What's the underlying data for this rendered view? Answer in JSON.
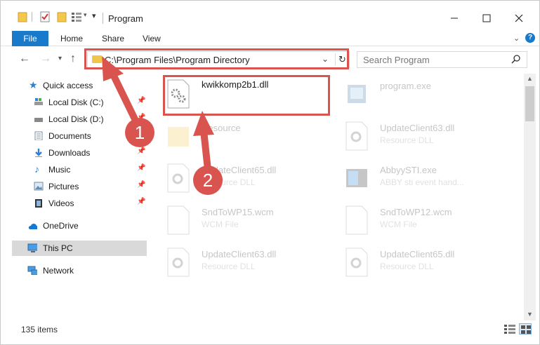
{
  "window": {
    "title": "Program"
  },
  "ribbon": {
    "tabs": [
      "File",
      "Home",
      "Share",
      "View"
    ]
  },
  "address": {
    "path": "C:\\Program Files\\Program Directory",
    "search_placeholder": "Search Program"
  },
  "nav": {
    "quick_access": "Quick access",
    "items": [
      {
        "label": "Local Disk (C:)",
        "pinned": true
      },
      {
        "label": "Local Disk (D:)",
        "pinned": true
      },
      {
        "label": "Documents",
        "pinned": true
      },
      {
        "label": "Downloads",
        "pinned": true
      },
      {
        "label": "Music",
        "pinned": true
      },
      {
        "label": "Pictures",
        "pinned": true
      },
      {
        "label": "Videos",
        "pinned": true
      }
    ],
    "onedrive": "OneDrive",
    "thispc": "This PC",
    "network": "Network"
  },
  "files": [
    {
      "name": "kwikkomp2b1.dll",
      "desc": "",
      "faded": false
    },
    {
      "name": "program.exe",
      "desc": "",
      "faded": true
    },
    {
      "name": "Resource",
      "desc": "",
      "faded": true
    },
    {
      "name": "UpdateClient63.dll",
      "desc": "Resource DLL",
      "faded": true
    },
    {
      "name": "UpdateClient65.dll",
      "desc": "Resource DLL",
      "faded": true
    },
    {
      "name": "AbbyySTI.exe",
      "desc": "ABBY sti event hand...",
      "faded": true
    },
    {
      "name": "SndToWP15.wcm",
      "desc": "WCM File",
      "faded": true
    },
    {
      "name": "SndToWP12.wcm",
      "desc": "WCM File",
      "faded": true
    },
    {
      "name": "UpdateClient63.dll",
      "desc": "Resource DLL",
      "faded": true
    },
    {
      "name": "UpdateClient65.dll",
      "desc": "Resource DLL",
      "faded": true
    }
  ],
  "status": {
    "count": "135 items"
  },
  "annotations": {
    "step1": "1",
    "step2": "2",
    "color": "#d9534f"
  }
}
